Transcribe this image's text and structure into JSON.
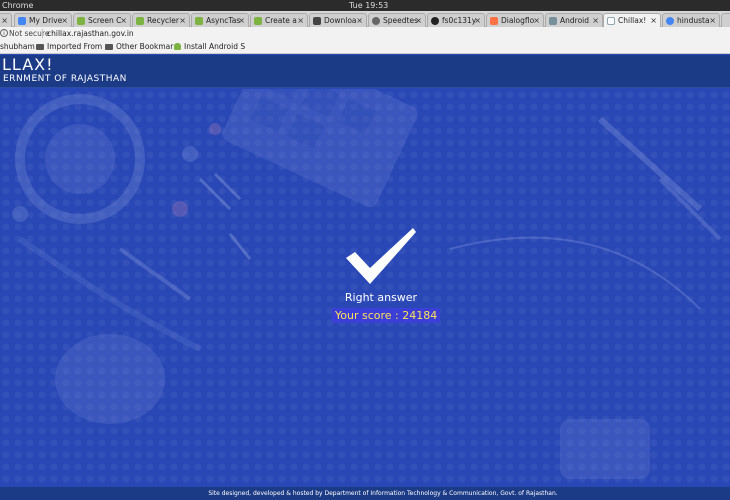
{
  "os": {
    "app_name": "Chrome",
    "clock": "Tue 19:53"
  },
  "tabs": [
    {
      "label": "My Drive",
      "fav_color": "#4285f4"
    },
    {
      "label": "Screen C",
      "fav_color": "#7cb342"
    },
    {
      "label": "Recycler",
      "fav_color": "#7cb342"
    },
    {
      "label": "AsyncTas",
      "fav_color": "#7cb342"
    },
    {
      "label": "Create a",
      "fav_color": "#7cb342"
    },
    {
      "label": "Downloa",
      "fav_color": "#444444"
    },
    {
      "label": "Speedtes",
      "fav_color": "#666666"
    },
    {
      "label": "fs0c131y",
      "fav_color": "#222222"
    },
    {
      "label": "Dialogflo",
      "fav_color": "#ff7043"
    },
    {
      "label": "Android",
      "fav_color": "#78909c"
    },
    {
      "label": "Chillax!",
      "fav_color": "#90a4ae"
    },
    {
      "label": "hindusta",
      "fav_color": "#4285f4"
    }
  ],
  "urlbar": {
    "security": "Not secure",
    "url": "chillax.rajasthan.gov.in"
  },
  "bookmarks": [
    {
      "label": "shubham",
      "icon": "folder-icon"
    },
    {
      "label": "Imported From",
      "icon": "folder-icon"
    },
    {
      "label": "Other Bookmar",
      "icon": "folder-icon"
    },
    {
      "label": "Install Android S",
      "icon": "android-icon"
    }
  ],
  "site": {
    "brand": "LLAX!",
    "government": "ERNMENT OF RAJASTHAN"
  },
  "result": {
    "message": "Right answer",
    "score_text": "Your score : 24184",
    "score": 24184
  },
  "footer": {
    "text": "Site designed, developed & hosted by Department of Information Technology & Communication, Govt. of Rajasthan."
  }
}
